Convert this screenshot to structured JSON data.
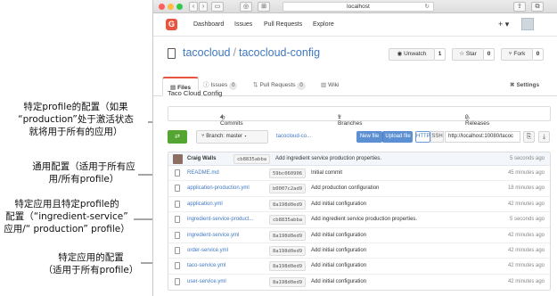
{
  "colors": {
    "accent": "#e8553e",
    "link": "#4078c0",
    "commit_green": "#55a532",
    "button_blue": "#5c90d2"
  },
  "annotations": [
    {
      "id": "active",
      "lines": [
        "特定profile的配置（如果",
        "“production”处于激活状态",
        "就将用于所有的应用）"
      ]
    },
    {
      "id": "general",
      "lines": [
        "通用配置（适用于所有应",
        "用/所有profile）"
      ]
    },
    {
      "id": "service-profile",
      "lines": [
        "特定应用且特定profile的",
        "配置（“ingredient-service”",
        "应用/“ production” profile）"
      ]
    },
    {
      "id": "app-specific",
      "lines": [
        "特定应用的配置",
        "（适用于所有profile）"
      ]
    }
  ],
  "browser": {
    "address": "localhost",
    "icons": [
      "back-icon",
      "forward-icon",
      "sidebar-icon",
      "shield-icon",
      "tab-grid-icon",
      "reload-icon",
      "share-icon",
      "new-tab-icon"
    ]
  },
  "gogs_nav": {
    "links": [
      "Dashboard",
      "Issues",
      "Pull Requests",
      "Explore"
    ],
    "plus": "+ ▾"
  },
  "repo": {
    "owner": "tacocloud",
    "separator": "/",
    "name": "tacocloud-config",
    "unwatch": {
      "label": "Unwatch",
      "count": "1"
    },
    "star": {
      "label": "Star",
      "count": "0"
    },
    "fork": {
      "label": "Fork",
      "count": "0"
    }
  },
  "tabs": [
    {
      "label": "Files",
      "count": ""
    },
    {
      "label": "Issues",
      "count": "0"
    },
    {
      "label": "Pull Requests",
      "count": "0"
    },
    {
      "label": "Wiki",
      "count": ""
    },
    {
      "label": "Settings",
      "count": ""
    }
  ],
  "description": "Taco Cloud Config",
  "summary": {
    "commits": "4 Commits",
    "branches": "1 Branches",
    "releases": "0 Releases"
  },
  "actions": {
    "branch_label": "Branch: master ▾",
    "path": "tacocloud-co...",
    "new_file": "New file",
    "upload_file": "Upload file",
    "http": "HTTP",
    "ssh": "SSH",
    "clone_url": "http://localhost:10080/tacoc"
  },
  "last_commit": {
    "author": "Craig Walls",
    "sha": "cb8835abba",
    "message": "Add ingredient service production properties.",
    "time": "5 seconds ago"
  },
  "files": [
    {
      "name": "README.md",
      "sha": "59bc060906",
      "message": "Initial commit",
      "time": "45 minutes ago"
    },
    {
      "name": "application-production.yml",
      "sha": "b0007c2ad9",
      "message": "Add production configuration",
      "time": "18 minutes ago"
    },
    {
      "name": "application.yml",
      "sha": "8a198d0ed9",
      "message": "Add initial configuration",
      "time": "42 minutes ago"
    },
    {
      "name": "ingredient-service-product...",
      "sha": "cb8835abba",
      "message": "Add ingredient service production properties.",
      "time": "5 seconds ago"
    },
    {
      "name": "ingredient-service.yml",
      "sha": "8a198d0ed9",
      "message": "Add initial configuration",
      "time": "42 minutes ago"
    },
    {
      "name": "order-service.yml",
      "sha": "8a198d0ed9",
      "message": "Add initial configuration",
      "time": "42 minutes ago"
    },
    {
      "name": "taco-service.yml",
      "sha": "8a198d0ed9",
      "message": "Add initial configuration",
      "time": "42 minutes ago"
    },
    {
      "name": "user-service.yml",
      "sha": "8a198d0ed9",
      "message": "Add initial configuration",
      "time": "42 minutes ago"
    }
  ]
}
